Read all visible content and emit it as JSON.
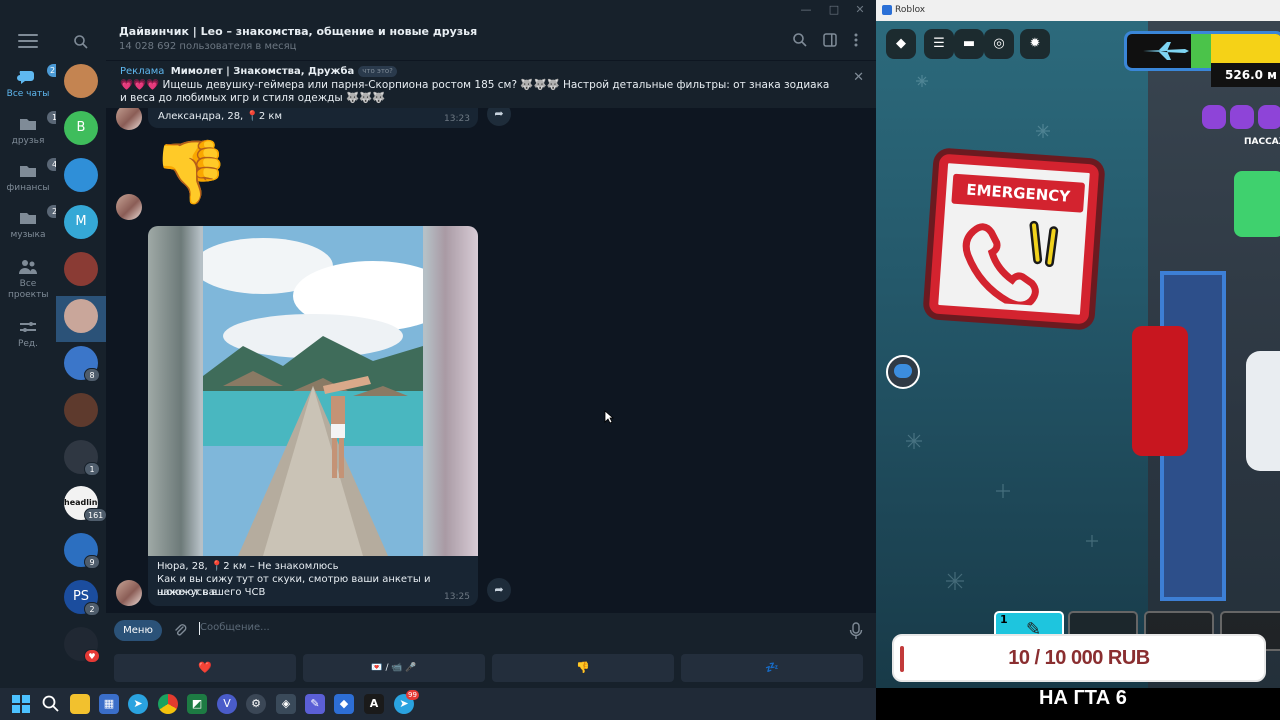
{
  "telegram": {
    "window_controls": [
      "—",
      "□",
      "✕"
    ],
    "folders": [
      {
        "label": "Все чаты",
        "badge": "21",
        "icon": "chats-icon",
        "active": true
      },
      {
        "label": "друзья",
        "badge": "1",
        "icon": "friends-icon"
      },
      {
        "label": "финансы",
        "badge": "4",
        "icon": "finance-icon"
      },
      {
        "label": "музыка",
        "badge": "2",
        "icon": "music-icon"
      },
      {
        "label": "Все проекты",
        "badge": "",
        "icon": "projects-icon"
      },
      {
        "label": "Ред.",
        "badge": "",
        "icon": "edit-icon"
      }
    ],
    "chat_rail": [
      {
        "initial": "",
        "color": "#c48451",
        "badge": ""
      },
      {
        "initial": "B",
        "color": "#3fbd5c",
        "badge": ""
      },
      {
        "initial": "",
        "color": "#2f8fd8",
        "badge": ""
      },
      {
        "initial": "M",
        "color": "#35a8d6",
        "badge": ""
      },
      {
        "initial": "",
        "color": "#8a3b34",
        "badge": ""
      },
      {
        "initial": "",
        "color": "#c9a69a",
        "badge": ""
      },
      {
        "initial": "",
        "color": "#3b76c9",
        "badge": "8"
      },
      {
        "initial": "",
        "color": "#5e3a2d",
        "badge": ""
      },
      {
        "initial": "",
        "color": "#2f3742",
        "badge": "1"
      },
      {
        "initial": "headlines",
        "color": "#f2f2f2",
        "badge": "161"
      },
      {
        "initial": "",
        "color": "#2c6fc0",
        "badge": "9"
      },
      {
        "initial": "PS",
        "color": "#1b4d9e",
        "badge": "2"
      },
      {
        "initial": "",
        "color": "#202833",
        "badge": "♥"
      }
    ],
    "header": {
      "title": "Дайвинчик | Leo – знакомства, общение и новые друзья",
      "subtitle": "14 028 692 пользователя в месяц"
    },
    "ad": {
      "label": "Реклама",
      "name": "Мимолет | Знакомства, Дружба",
      "tag": "что это?",
      "text": "💗💗💗 Ищешь девушку-геймера или парня-Скорпиона ростом 185 см? 🐺🐺🐺 Настрой детальные фильтры: от знака зодиака и веса до любимых игр и стиля одежды 🐺🐺🐺"
    },
    "messages": {
      "m1_text": "Александра, 28, 📍2 км",
      "m1_time": "13:23",
      "m2_sticker": "👎",
      "m3_text_line1": "Нюра, 28, 📍2 км – Не знакомлюсь",
      "m3_text_line2": "Как и вы сижу тут от скуки, смотрю ваши анкеты и нахожусь в",
      "m3_text_line3": "шоке от вашего ЧСВ",
      "m3_time": "13:25"
    },
    "composer": {
      "menu_label": "Меню",
      "placeholder": "Сообщение..."
    },
    "keyboard": [
      "❤️",
      "💌 / 📹 🎤",
      "👎",
      "💤"
    ]
  },
  "roblox": {
    "window_title": "Roblox",
    "distance": "526.0 м",
    "passenger_label": "ПАССАЖ",
    "sign_text": "EMERGENCY",
    "slot_number": "1",
    "donation": "10 / 10 000 RUB",
    "stream_caption": "НА ГТА 6"
  },
  "taskbar": {
    "items": [
      "start-icon",
      "search-icon",
      "file-explorer-icon",
      "store-icon",
      "telegram-icon",
      "chrome-icon",
      "excel-icon",
      "vpn-icon",
      "steam-icon",
      "app-icon",
      "tool-icon",
      "roblox-icon",
      "font-icon",
      "telegram-badge-icon"
    ],
    "telegram_badge": "99"
  }
}
